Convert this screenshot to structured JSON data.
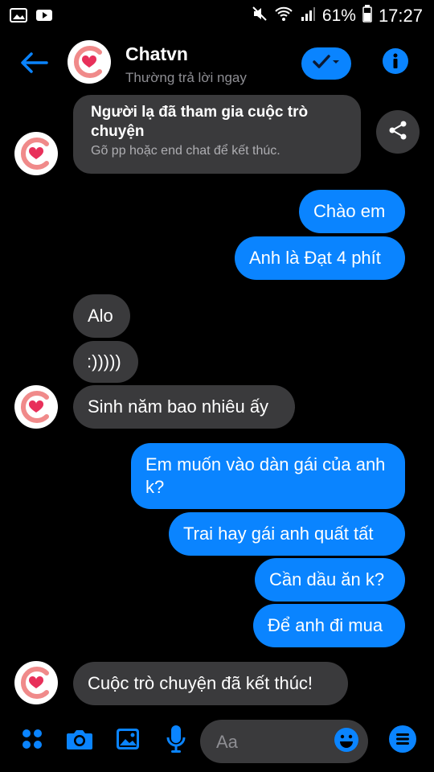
{
  "status_bar": {
    "battery": "61%",
    "time": "17:27"
  },
  "header": {
    "title": "Chatvn",
    "subtitle": "Thường trả lời ngay"
  },
  "system_message": {
    "title": "Người lạ đã tham gia cuộc trò chuyện",
    "subtitle": "Gõ pp hoặc end chat để kết thúc."
  },
  "messages": [
    {
      "text": "Chào em",
      "side": "out"
    },
    {
      "text": "Anh là Đạt 4 phít",
      "side": "out"
    },
    {
      "text": "Alo",
      "side": "in"
    },
    {
      "text": ":)))))",
      "side": "in"
    },
    {
      "text": "Sinh năm bao nhiêu ấy",
      "side": "in"
    },
    {
      "text": "Em muốn vào dàn gái của anh k?",
      "side": "out"
    },
    {
      "text": "Trai hay gái anh quất tất",
      "side": "out"
    },
    {
      "text": "Cần dầu ăn k?",
      "side": "out"
    },
    {
      "text": "Để anh đi mua",
      "side": "out"
    },
    {
      "text": "Cuộc trò chuyện đã kết thúc!",
      "side": "in"
    }
  ],
  "composer": {
    "placeholder": "Aa"
  },
  "colors": {
    "accent": "#0a84ff",
    "avatar_ring": "#f08080",
    "heart": "#e8305a"
  },
  "icons": [
    "image-icon",
    "youtube-icon",
    "mute-icon",
    "wifi-icon",
    "signal-icon",
    "battery-icon",
    "back-arrow-icon",
    "check-dropdown-icon",
    "info-icon",
    "share-icon",
    "apps-icon",
    "camera-icon",
    "gallery-icon",
    "mic-icon",
    "emoji-icon",
    "menu-icon"
  ]
}
